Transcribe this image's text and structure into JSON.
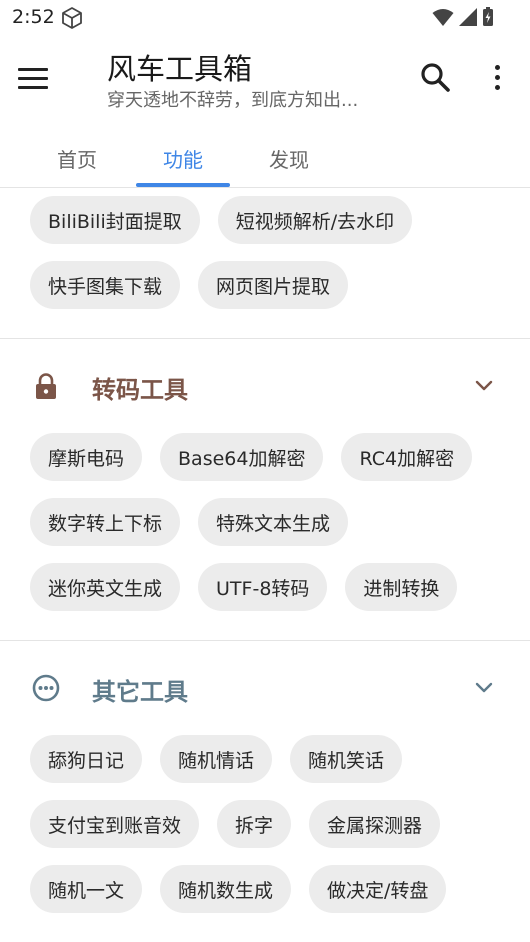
{
  "status_bar": {
    "time": "2:52"
  },
  "app_bar": {
    "title": "风车工具箱",
    "subtitle": "穿天透地不辞劳，到底方知出..."
  },
  "tabs": [
    {
      "label": "首页",
      "active": false
    },
    {
      "label": "功能",
      "active": true
    },
    {
      "label": "发现",
      "active": false
    }
  ],
  "colors": {
    "accent": "#3f86e6",
    "chip_bg": "#ececec",
    "transcode_title": "#7b5548",
    "other_title": "#5f7b8b"
  },
  "partial_section": {
    "rows": [
      [
        "BiliBili封面提取",
        "短视频解析/去水印"
      ],
      [
        "快手图集下载",
        "网页图片提取"
      ]
    ]
  },
  "transcode_section": {
    "title": "转码工具",
    "icon": "lock-icon",
    "rows": [
      [
        "摩斯电码",
        "Base64加解密",
        "RC4加解密"
      ],
      [
        "数字转上下标",
        "特殊文本生成"
      ],
      [
        "迷你英文生成",
        "UTF-8转码",
        "进制转换"
      ]
    ]
  },
  "other_section": {
    "title": "其它工具",
    "icon": "more-circle-icon",
    "rows": [
      [
        "舔狗日记",
        "随机情话",
        "随机笑话"
      ],
      [
        "支付宝到账音效",
        "拆字",
        "金属探测器"
      ],
      [
        "随机一文",
        "随机数生成",
        "做决定/转盘"
      ]
    ]
  }
}
